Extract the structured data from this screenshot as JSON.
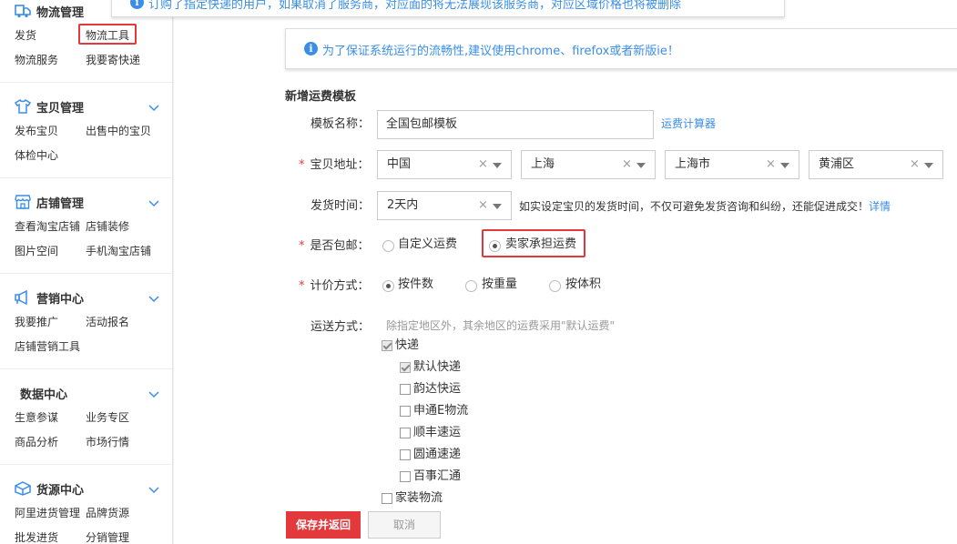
{
  "sidebar": {
    "sections": [
      {
        "title": "物流管理",
        "icon": "logistics-icon",
        "links": [
          "发货",
          "物流工具",
          "物流服务",
          "我要寄快递"
        ]
      },
      {
        "title": "宝贝管理",
        "icon": "tshirt-icon",
        "links": [
          "发布宝贝",
          "出售中的宝贝",
          "体检中心"
        ]
      },
      {
        "title": "店铺管理",
        "icon": "store-icon",
        "links": [
          "查看淘宝店铺",
          "店铺装修",
          "图片空间",
          "手机淘宝店铺"
        ]
      },
      {
        "title": "营销中心",
        "icon": "megaphone-icon",
        "links": [
          "我要推广",
          "活动报名",
          "店铺营销工具"
        ]
      },
      {
        "title": "数据中心",
        "icon": "",
        "links": [
          "生意参谋",
          "业务专区",
          "商品分析",
          "市场行情"
        ]
      },
      {
        "title": "货源中心",
        "icon": "supply-icon",
        "links": [
          "阿里进货管理",
          "品牌货源",
          "批发进货",
          "分销管理"
        ]
      }
    ]
  },
  "notices": {
    "top": "订购了指定快递的用户，如果取消了服务商，对应面的将无法展现该服务商，对应区域价格也将被删除",
    "browser": "为了保证系统运行的流畅性,建议使用chrome、firefox或者新版ie！"
  },
  "form": {
    "title": "新增运费模板",
    "template_name": {
      "label": "模板名称：",
      "value": "全国包邮模板",
      "link": "运费计算器"
    },
    "address": {
      "label": "宝贝地址：",
      "country": "中国",
      "province": "上海",
      "city": "上海市",
      "district": "黄浦区"
    },
    "ship_time": {
      "label": "发货时间：",
      "value": "2天内",
      "hint": "如实设定宝贝的发货时间，不仅可避免发货咨询和纠纷，还能促进成交！",
      "link": "详情"
    },
    "free_shipping": {
      "label": "是否包邮：",
      "option1": "自定义运费",
      "option2": "卖家承担运费",
      "selected": "卖家承担运费"
    },
    "pricing": {
      "label": "计价方式：",
      "option1": "按件数",
      "option2": "按重量",
      "option3": "按体积",
      "selected": "按件数"
    },
    "delivery": {
      "label": "运送方式：",
      "hint": "除指定地区外，其余地区的运费采用\"默认运费\"",
      "express": "快递",
      "sub": [
        "默认快递",
        "韵达快运",
        "申通E物流",
        "顺丰速运",
        "圆通速递",
        "百事汇通"
      ],
      "home": "家装物流"
    },
    "save_label": "保存并返回",
    "cancel_label": "取消"
  },
  "colors": {
    "accent_red": "#e4393c",
    "link_blue": "#3a8ee6"
  }
}
